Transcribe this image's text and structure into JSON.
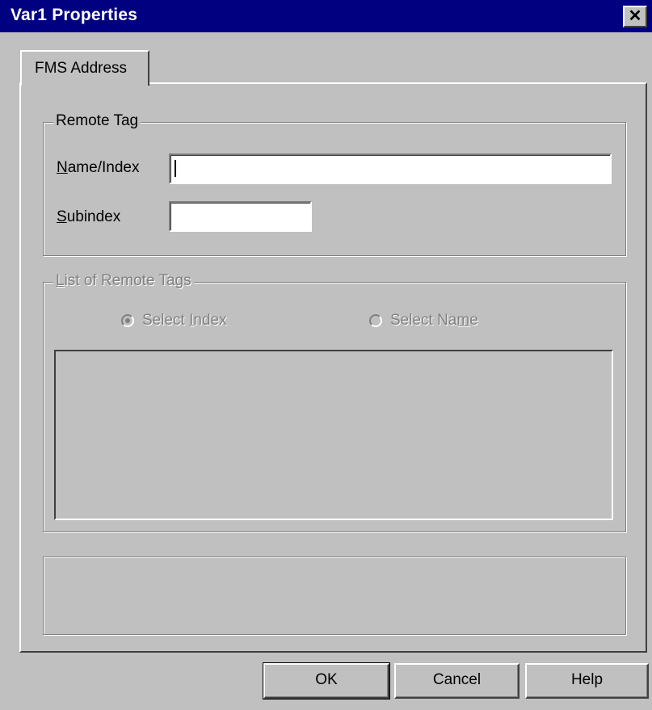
{
  "window": {
    "title": "Var1 Properties",
    "close_glyph": "✕"
  },
  "tabs": [
    {
      "label": "FMS Address"
    }
  ],
  "remote_tag": {
    "legend": "Remote Tag",
    "name_index": {
      "label_accel": "N",
      "label_rest": "ame/Index",
      "value": ""
    },
    "subindex": {
      "label_accel": "S",
      "label_rest": "ubindex",
      "value": ""
    }
  },
  "list_of_remote_tags": {
    "legend_accel": "L",
    "legend_rest": "ist of Remote Tags",
    "select_index": {
      "label_pre": "Select ",
      "label_accel": "I",
      "label_post": "ndex",
      "checked": true
    },
    "select_name": {
      "label_pre": "Select Na",
      "label_accel": "m",
      "label_post": "e",
      "checked": false
    }
  },
  "buttons": {
    "ok": "OK",
    "cancel": "Cancel",
    "help": "Help"
  }
}
